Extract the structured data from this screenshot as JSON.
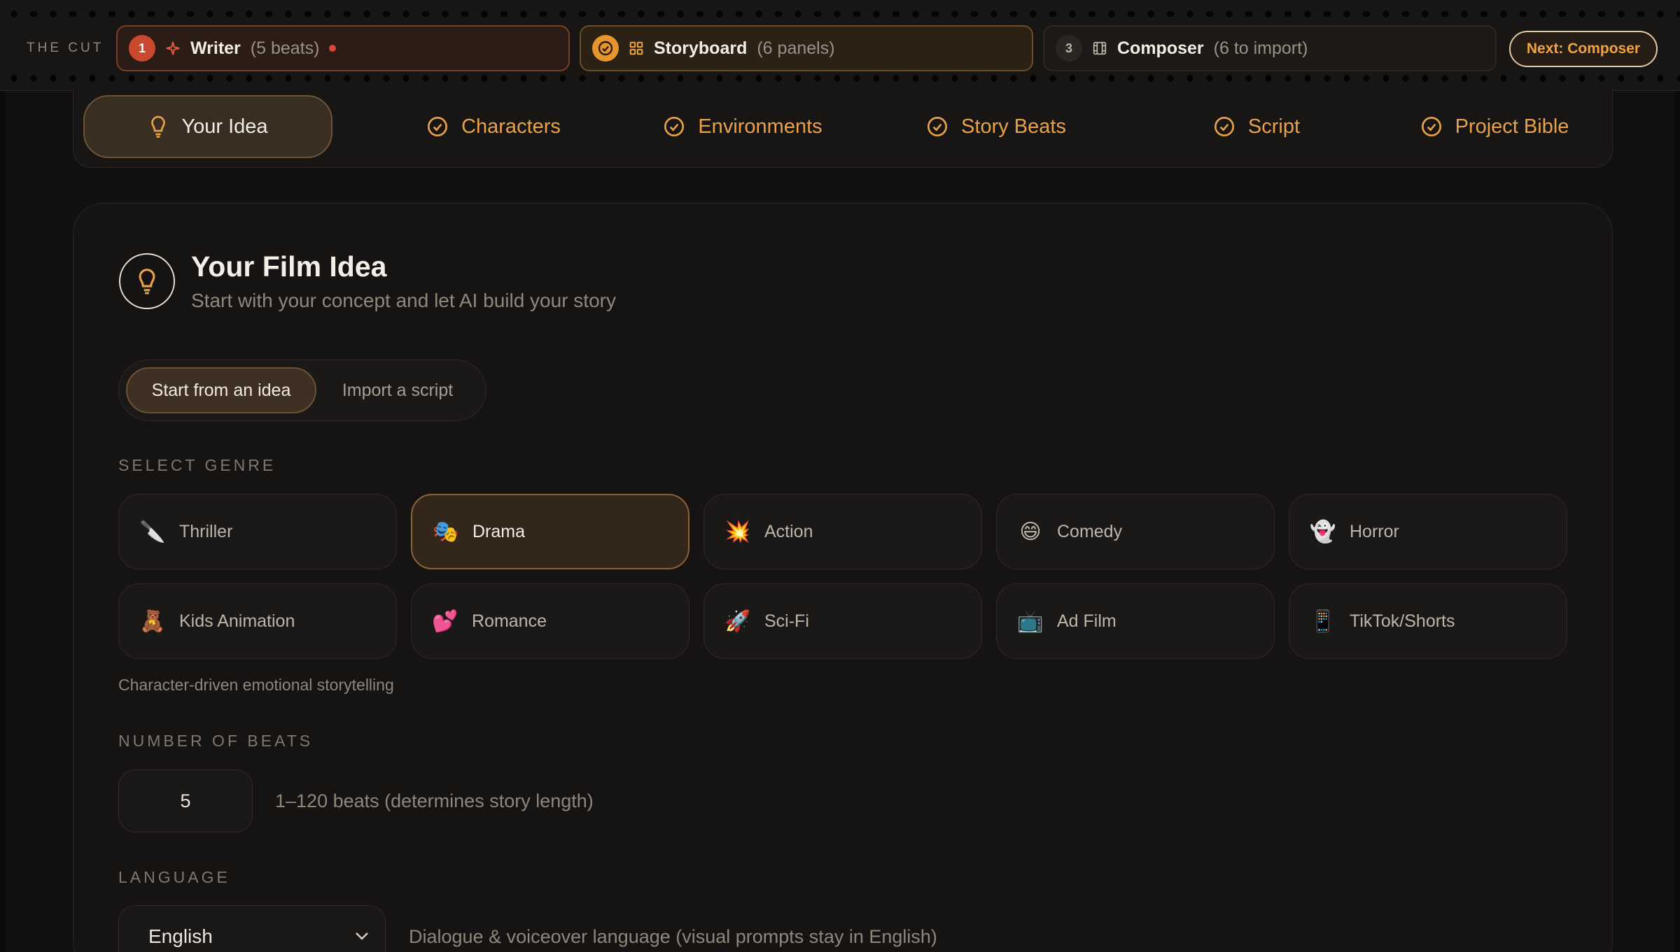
{
  "app": {
    "brand": "THE CUT"
  },
  "steps": [
    {
      "num": "1",
      "label": "Writer",
      "count": "(5 beats)",
      "icon": "sparkle-icon"
    },
    {
      "num": "",
      "label": "Storyboard",
      "count": "(6 panels)",
      "icon": "grid-icon",
      "badge_icon": "check-circle-icon"
    },
    {
      "num": "3",
      "label": "Composer",
      "count": "(6 to import)",
      "icon": "film-icon"
    }
  ],
  "next_button": "Next: Composer",
  "tabs": [
    {
      "label": "Your Idea",
      "icon": "lightbulb-icon",
      "active": true
    },
    {
      "label": "Characters",
      "icon": "check-circle-icon"
    },
    {
      "label": "Environments",
      "icon": "check-circle-icon"
    },
    {
      "label": "Story Beats",
      "icon": "check-circle-icon"
    },
    {
      "label": "Script",
      "icon": "check-circle-icon"
    },
    {
      "label": "Project Bible",
      "icon": "check-circle-icon"
    }
  ],
  "header": {
    "title": "Your Film Idea",
    "subtitle": "Start with your concept and let AI build your story"
  },
  "mode": {
    "idea": "Start from an idea",
    "import": "Import a script",
    "selected": "Start from an idea"
  },
  "genre": {
    "label": "SELECT GENRE",
    "selected": "Drama",
    "description": "Character-driven emotional storytelling",
    "options": [
      {
        "label": "Thriller",
        "emoji": "🔪"
      },
      {
        "label": "Drama",
        "emoji": "🎭"
      },
      {
        "label": "Action",
        "emoji": "💥"
      },
      {
        "label": "Comedy",
        "emoji": "😄"
      },
      {
        "label": "Horror",
        "emoji": "👻"
      },
      {
        "label": "Kids Animation",
        "emoji": "🧸"
      },
      {
        "label": "Romance",
        "emoji": "💕"
      },
      {
        "label": "Sci-Fi",
        "emoji": "🚀"
      },
      {
        "label": "Ad Film",
        "emoji": "📺"
      },
      {
        "label": "TikTok/Shorts",
        "emoji": "📱"
      }
    ]
  },
  "beats": {
    "label": "NUMBER OF BEATS",
    "value": "5",
    "hint": "1–120 beats (determines story length)"
  },
  "language": {
    "label": "LANGUAGE",
    "value": "English",
    "hint": "Dialogue & voiceover language (visual prompts stay in English)"
  },
  "colors": {
    "accent": "#e9a24a",
    "writer_red": "#c9482e",
    "background": "#111110"
  }
}
